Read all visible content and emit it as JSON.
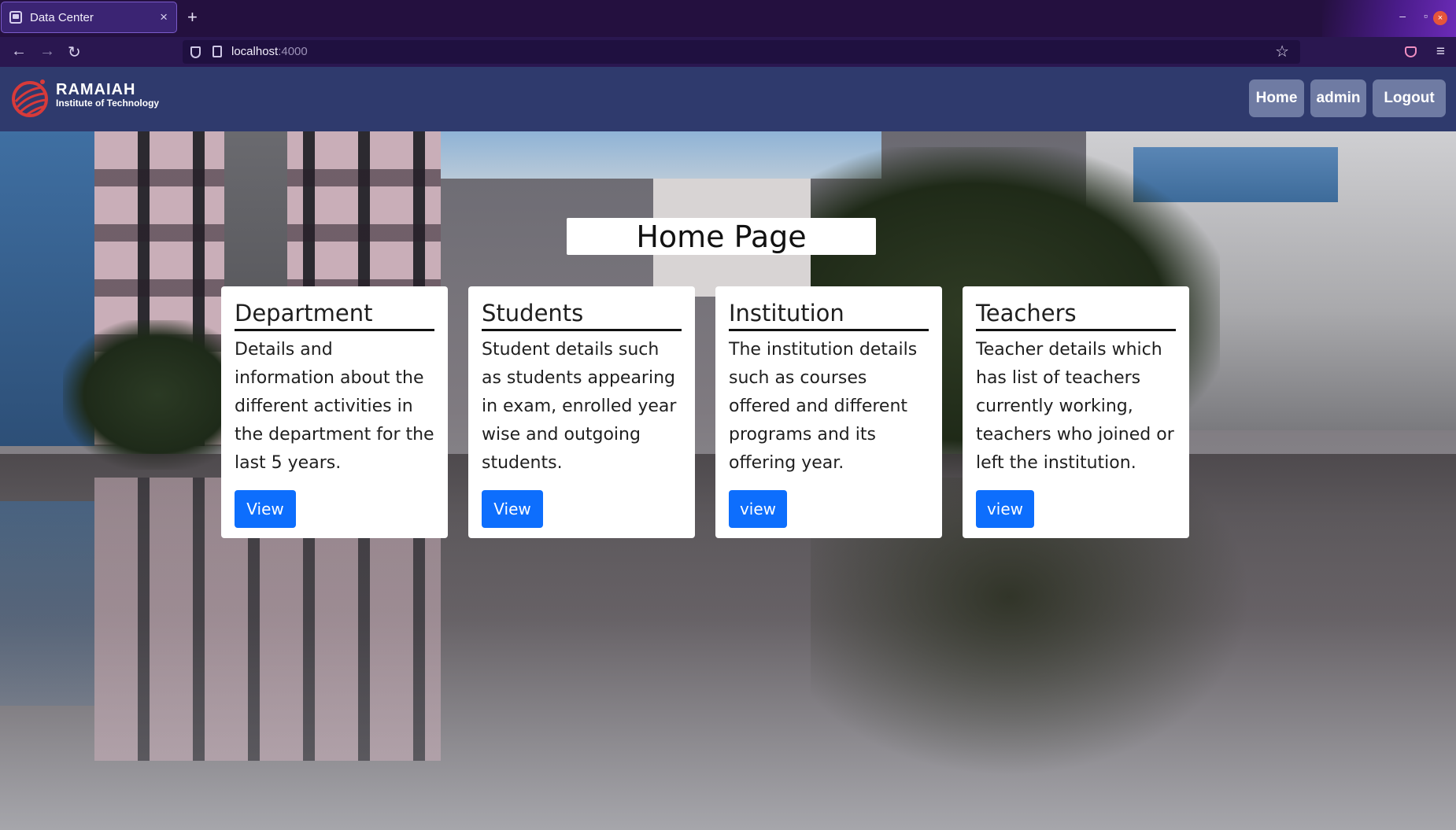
{
  "browser": {
    "tab_title": "Data Center",
    "tab_close": "×",
    "new_tab": "+",
    "url_host": "localhost",
    "url_port": ":4000",
    "window_minimize": "–",
    "window_maximize": "▫",
    "window_close": "×",
    "back": "←",
    "forward": "→",
    "reload": "↻",
    "bookmark_star": "☆",
    "menu": "≡"
  },
  "header": {
    "brand_name": "RAMAIAH",
    "brand_subtitle": "Institute of Technology",
    "nav": [
      {
        "label": "Home"
      },
      {
        "label": "admin"
      },
      {
        "label": "Logout"
      }
    ]
  },
  "main": {
    "page_title": "Home Page",
    "cards": [
      {
        "title": "Department",
        "text": "Details and information about the different activities in the department for the last 5 years.",
        "button": "View"
      },
      {
        "title": "Students",
        "text": "Student details such as students appearing in exam, enrolled year wise and outgoing students.",
        "button": "View"
      },
      {
        "title": "Institution",
        "text": "The institution details such as courses offered and different programs and its offering year.",
        "button": "view"
      },
      {
        "title": "Teachers",
        "text": "Teacher details which has list of teachers currently working, teachers who joined or left the institution.",
        "button": "view"
      }
    ]
  },
  "colors": {
    "header_bg": "#2f3a6d",
    "nav_button_bg": "#6f7ba3",
    "primary_button": "#0d6efd",
    "browser_tabbar": "#24103f",
    "logo_red": "#d83a3a"
  }
}
